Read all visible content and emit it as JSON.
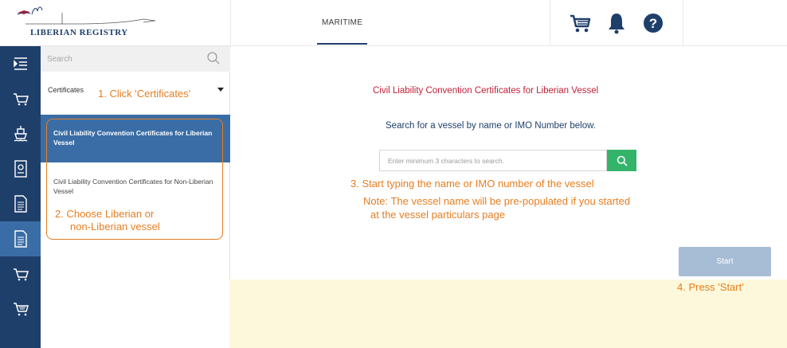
{
  "logo": {
    "text": "LIBERIAN REGISTRY",
    "icon": "flag-signature-logo"
  },
  "header": {
    "tab": "MARITIME",
    "icons": [
      "cart-icon",
      "bell-icon",
      "help-icon"
    ],
    "accent": "#1f3f6b"
  },
  "rail": {
    "icons": [
      "menu-icon",
      "cart-icon",
      "ship-icon",
      "passport-icon",
      "document-icon",
      "document-icon",
      "cart-icon",
      "ship-cart-icon"
    ],
    "active_index": 5
  },
  "sidebar": {
    "search_placeholder": "Search",
    "category": "Certificates",
    "items": [
      {
        "label": "Civil Liability Convention Certificates for Liberian Vessel",
        "active": true
      },
      {
        "label": "Civil Liability Convention Certificates for Non-Liberian Vessel",
        "active": false
      }
    ]
  },
  "annotations": {
    "step1": "1. Click 'Certificates'",
    "step2_line1": "2. Choose Liberian or",
    "step2_line2": "non-Liberian vessel",
    "step3": "3. Start typing the name or IMO number of the vessel",
    "note_line1": "Note: The vessel name will be pre-populated if you started",
    "note_line2": "at the vessel particulars page",
    "step4": "4. Press 'Start'",
    "color": "#e67e22"
  },
  "main": {
    "title": "Civil Liability Convention Certificates for Liberian Vessel",
    "subtitle": "Search for a vessel by name or IMO Number below.",
    "search_placeholder": "Enter minimum 3 characters to search.",
    "start_label": "Start",
    "title_color": "#c0213a",
    "search_button_color": "#34b36b"
  }
}
